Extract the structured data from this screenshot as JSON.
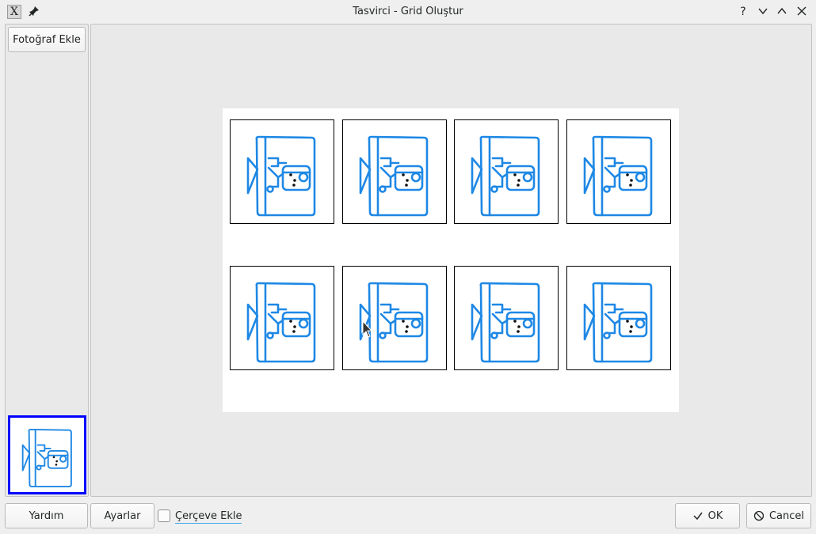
{
  "window": {
    "title": "Tasvirci - Grid Oluştur",
    "app_icon_glyph": "X",
    "title_buttons": [
      "help-icon",
      "minimize-icon",
      "maximize-icon",
      "close-icon"
    ]
  },
  "sidebar": {
    "add_photo_label": "Fotoğraf Ekle",
    "photos": [
      {
        "icon": "desk-person-illustration",
        "selected": true
      }
    ]
  },
  "grid": {
    "rows": 2,
    "columns": 4,
    "cells": [
      {
        "image": "desk-person-illustration"
      },
      {
        "image": "desk-person-illustration"
      },
      {
        "image": "desk-person-illustration"
      },
      {
        "image": "desk-person-illustration"
      },
      {
        "image": "desk-person-illustration"
      },
      {
        "image": "desk-person-illustration"
      },
      {
        "image": "desk-person-illustration"
      },
      {
        "image": "desk-person-illustration"
      }
    ]
  },
  "footer": {
    "help_label": "Yardım",
    "settings_label": "Ayarlar",
    "frame_checkbox_label": "Çerçeve Ekle",
    "frame_checked": false,
    "ok_label": "OK",
    "cancel_label": "Cancel"
  },
  "colors": {
    "illustration": "#1e88e5",
    "selection_border": "#0000ff",
    "focus_underline": "#3daee9"
  }
}
